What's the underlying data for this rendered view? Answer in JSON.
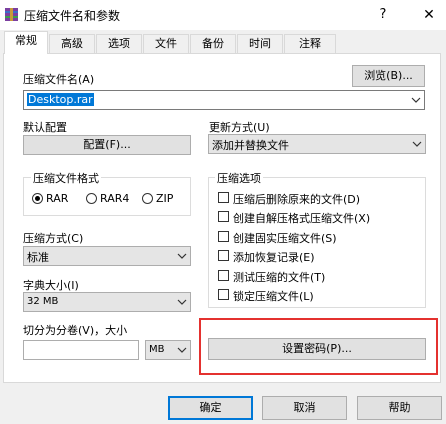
{
  "window": {
    "title": "压缩文件名和参数",
    "help": "?",
    "close": "✕"
  },
  "tabs": [
    "常规",
    "高级",
    "选项",
    "文件",
    "备份",
    "时间",
    "注释"
  ],
  "archive_name": {
    "label": "压缩文件名(A)",
    "value": "Desktop.rar",
    "browse_label": "浏览(B)..."
  },
  "profile": {
    "label": "默认配置",
    "button_label": "配置(F)..."
  },
  "update_mode": {
    "label": "更新方式(U)",
    "value": "添加并替换文件"
  },
  "format": {
    "label": "压缩文件格式",
    "options": [
      "RAR",
      "RAR4",
      "ZIP"
    ],
    "selected": "RAR"
  },
  "method": {
    "label": "压缩方式(C)",
    "value": "标准"
  },
  "dictionary": {
    "label": "字典大小(I)",
    "value": "32 MB"
  },
  "split": {
    "label": "切分为分卷(V)，大小",
    "unit": "MB"
  },
  "archive_options": {
    "label": "压缩选项",
    "items": [
      "压缩后删除原来的文件(D)",
      "创建自解压格式压缩文件(X)",
      "创建固实压缩文件(S)",
      "添加恢复记录(E)",
      "测试压缩的文件(T)",
      "锁定压缩文件(L)"
    ]
  },
  "set_password_label": "设置密码(P)...",
  "footer": {
    "ok": "确定",
    "cancel": "取消",
    "help": "帮助"
  },
  "colors": {
    "accent": "#0078d7",
    "highlight_box": "#e4312f"
  }
}
